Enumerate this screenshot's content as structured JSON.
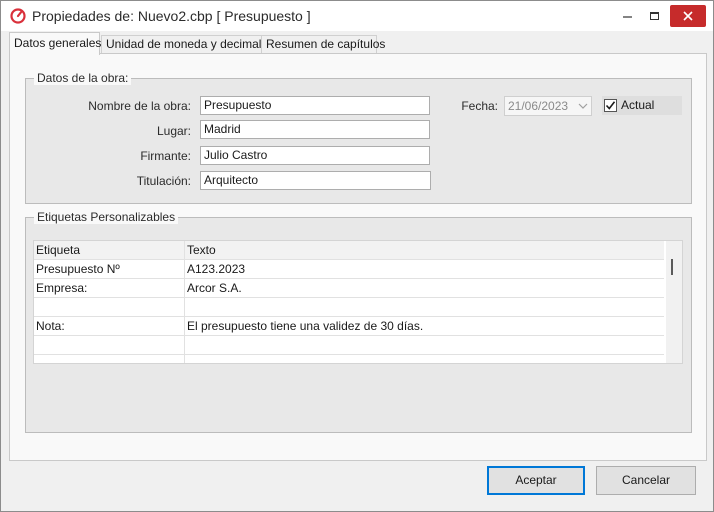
{
  "window": {
    "title": "Propiedades de: Nuevo2.cbp [ Presupuesto ]",
    "accent": "#d9303b"
  },
  "tabs": [
    {
      "label": "Datos generales",
      "active": true
    },
    {
      "label": "Unidad de moneda y decimales",
      "active": false
    },
    {
      "label": "Resumen de capítulos",
      "active": false
    }
  ],
  "obra": {
    "group_title": "Datos de la obra:",
    "nombre_label": "Nombre de la obra:",
    "nombre_value": "Presupuesto",
    "lugar_label": "Lugar:",
    "lugar_value": "Madrid",
    "firmante_label": "Firmante:",
    "firmante_value": "Julio Castro",
    "titulacion_label": "Titulación:",
    "titulacion_value": "Arquitecto",
    "fecha_label": "Fecha:",
    "fecha_value": "21/06/2023",
    "actual_label": "Actual",
    "actual_checked": true
  },
  "etiquetas": {
    "group_title": "Etiquetas Personalizables",
    "columns": [
      "Etiqueta",
      "Texto"
    ],
    "rows": [
      [
        "Presupuesto Nº",
        "A123.2023"
      ],
      [
        "Empresa:",
        "Arcor S.A."
      ],
      [
        "",
        ""
      ],
      [
        "Nota:",
        "El presupuesto tiene una validez de 30 días."
      ],
      [
        "",
        ""
      ],
      [
        "",
        ""
      ]
    ]
  },
  "buttons": {
    "accept": "Aceptar",
    "cancel": "Cancelar"
  }
}
